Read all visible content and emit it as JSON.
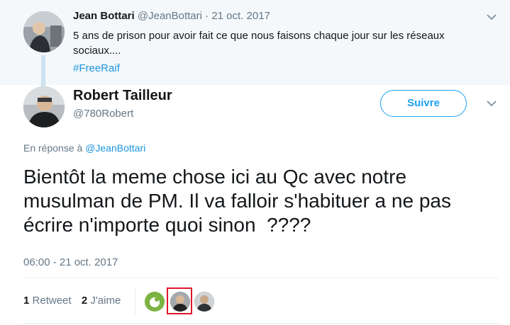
{
  "parent_tweet": {
    "name": "Jean Bottari",
    "handle": "@JeanBottari",
    "separator": "·",
    "date": "21 oct. 2017",
    "text": "5 ans de prison pour avoir fait ce que nous faisons chaque jour sur les réseaux sociaux....",
    "hashtag": "#FreeRaif",
    "menu_icon": "chevron-down-icon"
  },
  "main_tweet": {
    "name": "Robert Tailleur",
    "handle": "@780Robert",
    "follow_label": "Suivre",
    "reply_prefix": "En réponse à",
    "reply_to": "@JeanBottari",
    "text": "Bientôt la meme chose ici au Qc avec notre musulman de PM. Il va falloir s'habituer a ne pas écrire n'importe quoi sinon  ????",
    "timestamp": "06:00 - 21 oct. 2017",
    "menu_icon": "chevron-down-icon"
  },
  "stats": {
    "retweets_count": "1",
    "retweets_label": "Retweet",
    "likes_count": "2",
    "likes_label": "J'aime"
  },
  "colors": {
    "accent": "#1da1f2",
    "link": "#1b95e0",
    "muted": "#657786",
    "highlight_box": "#e0162b"
  }
}
